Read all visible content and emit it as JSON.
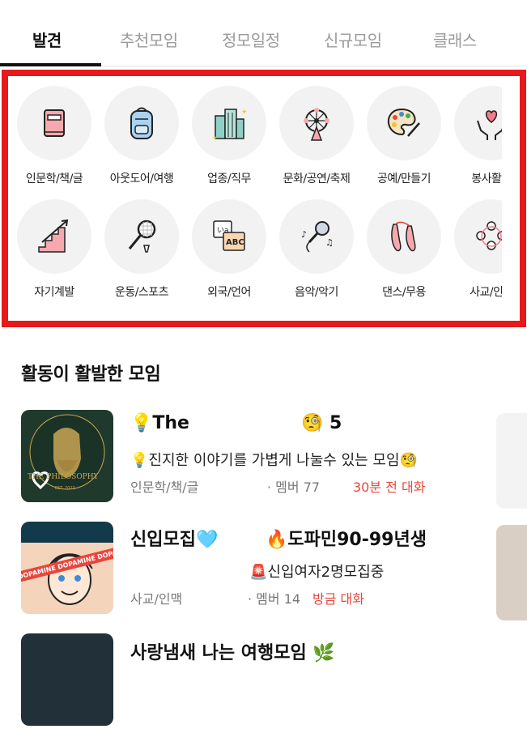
{
  "tabs": [
    {
      "label": "발견",
      "active": true
    },
    {
      "label": "추천모임"
    },
    {
      "label": "정모일정"
    },
    {
      "label": "신규모임"
    },
    {
      "label": "클래스"
    }
  ],
  "categories": [
    {
      "label": "인문학/책/글",
      "icon": "book-icon"
    },
    {
      "label": "아웃도어/여행",
      "icon": "backpack-icon"
    },
    {
      "label": "업종/직무",
      "icon": "buildings-icon"
    },
    {
      "label": "문화/공연/축제",
      "icon": "ferris-wheel-icon"
    },
    {
      "label": "공예/만들기",
      "icon": "palette-icon"
    },
    {
      "label": "봉사활동",
      "icon": "heart-hands-icon"
    },
    {
      "label": "자기계발",
      "icon": "stairs-icon"
    },
    {
      "label": "운동/스포츠",
      "icon": "badminton-icon"
    },
    {
      "label": "외국/언어",
      "icon": "language-cards-icon"
    },
    {
      "label": "음악/악기",
      "icon": "microphone-icon"
    },
    {
      "label": "댄스/무용",
      "icon": "ballet-shoes-icon"
    },
    {
      "label": "사교/인맥",
      "icon": "people-icon"
    }
  ],
  "section": {
    "title": "활동이 활발한 모임"
  },
  "groups": [
    {
      "title_start": "💡The",
      "title_end": "🧐 5",
      "desc": "💡진지한 이야기를 가볍게 나눌수 있는 모임🧐",
      "category": "인문학/책/글",
      "members": "· 멤버 77",
      "activity": "30분 전 대화",
      "thumb_text": "THE PHILOSOPHY",
      "thumb_sub": "EST. 2022"
    },
    {
      "title_start": "신입모집🩵",
      "title_end": "🔥도파민90-99년생",
      "desc": "🚨신입여자2명모집중",
      "category": "사교/인맥",
      "members": "· 멤버 14",
      "activity": "방금 대화",
      "thumb_text": "DOPAMINE DOPAMINE DOPAMINE"
    },
    {
      "title_start": "사랑냄새 나는 여행모임 🌿"
    }
  ],
  "colors": {
    "highlight": "#e8191c",
    "active_text": "#e8453c"
  }
}
